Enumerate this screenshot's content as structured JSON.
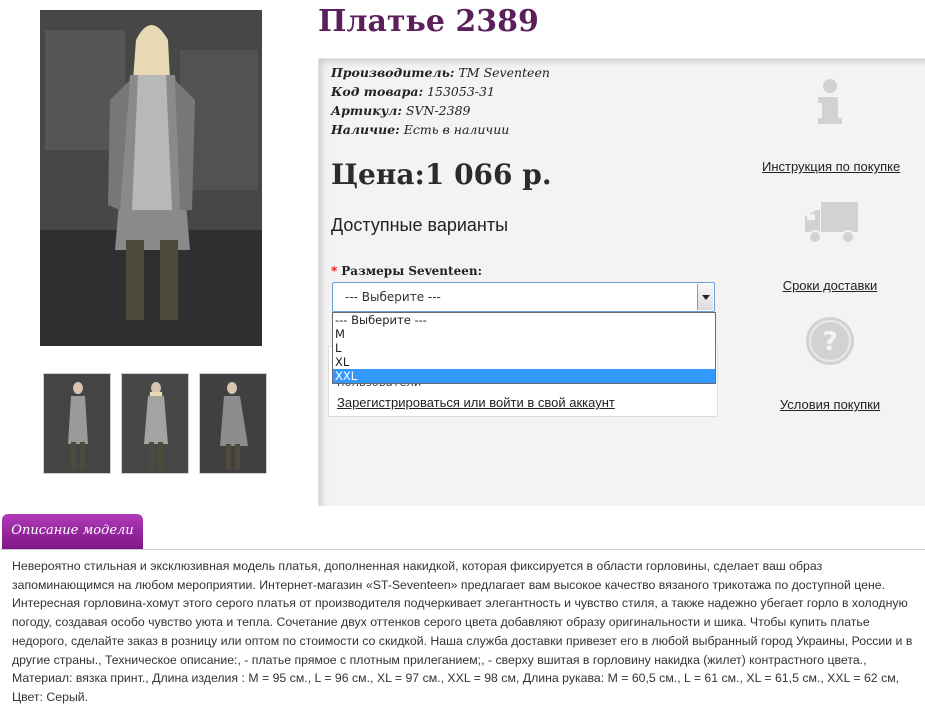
{
  "product": {
    "title": "Платье 2389",
    "specs": [
      {
        "label": "Производитель:",
        "value": "TM Seventeen"
      },
      {
        "label": "Код товара:",
        "value": "153053-31"
      },
      {
        "label": "Артикул:",
        "value": "SVN-2389"
      },
      {
        "label": "Наличие:",
        "value": "Есть в наличии"
      }
    ],
    "price": "Цена:1 066 р."
  },
  "options": {
    "heading": "Доступные варианты",
    "required_mark": "*",
    "size_label": "Размеры Seventeen:",
    "select_value": "--- Выберите ---",
    "dropdown_options": [
      "--- Выберите ---",
      "M",
      "L",
      "XL",
      "XXL"
    ],
    "highlighted_option": "XXL"
  },
  "login": {
    "note_text": "пользователи",
    "link_text": "Зарегистрироваться или войти в свой аккаунт"
  },
  "side_links": {
    "instructions": "Инструкция по покупке",
    "delivery": "Сроки доставки",
    "conditions": "Условия покупки"
  },
  "description": {
    "tab_label": "Описание модели",
    "text": "Невероятно стильная и эксклюзивная модель платья, дополненная накидкой, которая фиксируется в области горловины, сделает ваш образ запоминающимся на любом мероприятии. Интернет-магазин «ST-Seventeen» предлагает вам высокое качество вязаного трикотажа по доступной цене. Интересная горловина-хомут этого серого платья от производителя подчеркивает элегантность и чувство стиля, а также надежно убегает горло в холодную погоду, создавая особо чувство уюта и тепла. Сочетание двух оттенков серого цвета добавляют образу оригинальности и шика. Чтобы купить платье недорого, сделайте заказ в розницу или оптом по стоимости со скидкой. Наша служба доставки привезет его в любой выбранный город Украины, России и в другие страны., Техническое описание:, - платье прямое с плотным прилеганием;, - сверху вшитая в горловину накидка (жилет) контрастного цвета., Материал: вязка принт., Длина изделия : M = 95 см., L = 96 см., XL = 97 см., XXL = 98 см, Длина рукава: M = 60,5 см., L = 61 см., XL = 61,5 см., XXL = 62 см, Цвет: Серый."
  },
  "icons": {
    "info": "info-icon",
    "delivery": "truck-icon",
    "conditions": "question-icon"
  },
  "colors": {
    "title": "#5b1f5b",
    "tab_top": "#b13bb9",
    "tab_bottom": "#7c1585",
    "selected_option": "#3399ff",
    "panel_bg": "#f3f3f3"
  }
}
